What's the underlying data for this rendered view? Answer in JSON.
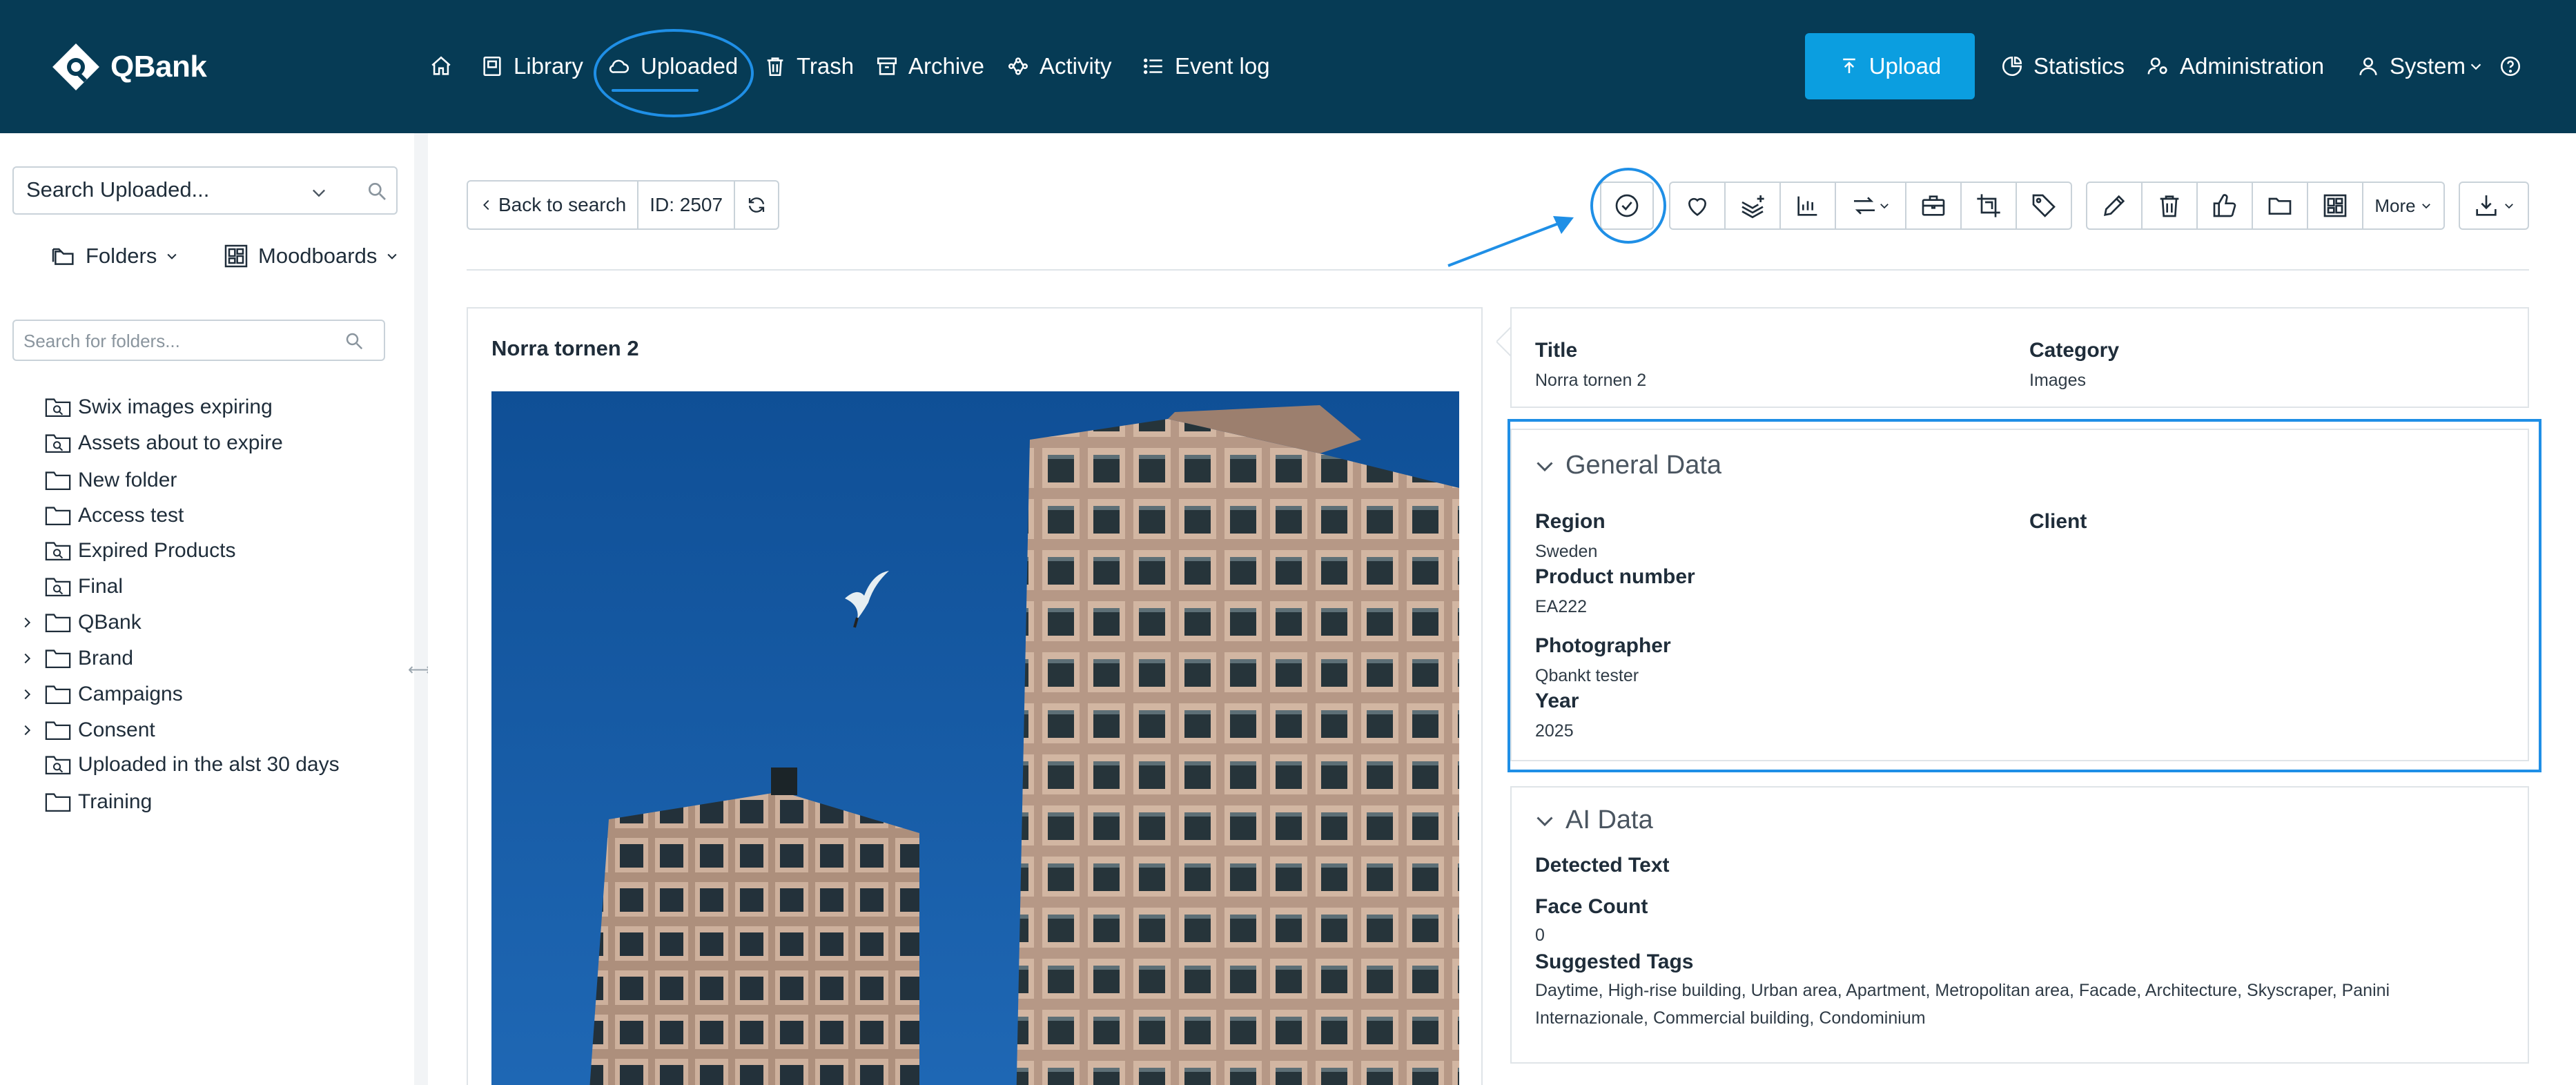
{
  "brand": {
    "name": "QBank"
  },
  "nav": {
    "home": "",
    "library": "Library",
    "uploaded": "Uploaded",
    "trash": "Trash",
    "archive": "Archive",
    "activity": "Activity",
    "eventlog": "Event log",
    "upload": "Upload",
    "statistics": "Statistics",
    "administration": "Administration",
    "system": "System"
  },
  "sidebar": {
    "search_value": "Search Uploaded...",
    "folders_label": "Folders",
    "moodboards_label": "Moodboards",
    "folder_search_placeholder": "Search for folders...",
    "items": [
      {
        "label": "Swix images expiring",
        "type": "smart",
        "expandable": false
      },
      {
        "label": "Assets about to expire",
        "type": "smart",
        "expandable": false
      },
      {
        "label": "New folder",
        "type": "folder",
        "expandable": false
      },
      {
        "label": "Access test",
        "type": "folder",
        "expandable": false
      },
      {
        "label": "Expired Products",
        "type": "smart",
        "expandable": false
      },
      {
        "label": "Final",
        "type": "smart",
        "expandable": false
      },
      {
        "label": "QBank",
        "type": "folder",
        "expandable": true
      },
      {
        "label": "Brand",
        "type": "folder",
        "expandable": true
      },
      {
        "label": "Campaigns",
        "type": "folder",
        "expandable": true
      },
      {
        "label": "Consent",
        "type": "folder",
        "expandable": true
      },
      {
        "label": "Uploaded in the alst 30 days",
        "type": "smart",
        "expandable": false
      },
      {
        "label": "Training",
        "type": "folder",
        "expandable": false
      }
    ]
  },
  "toolbar": {
    "back_label": "Back to search",
    "id_label": "ID: 2507",
    "more_label": "More"
  },
  "preview": {
    "title": "Norra tornen 2"
  },
  "summary": {
    "title_label": "Title",
    "title_value": "Norra tornen 2",
    "category_label": "Category",
    "category_value": "Images"
  },
  "general": {
    "heading": "General Data",
    "region_label": "Region",
    "region_value": "Sweden",
    "client_label": "Client",
    "product_label": "Product number",
    "product_value": "EA222",
    "photographer_label": "Photographer",
    "photographer_value": "Qbankt tester",
    "year_label": "Year",
    "year_value": "2025"
  },
  "ai": {
    "heading": "AI Data",
    "detected_label": "Detected Text",
    "face_label": "Face Count",
    "face_value": "0",
    "tags_label": "Suggested Tags",
    "tags_line1": "Daytime, High-rise building, Urban area, Apartment, Metropolitan area, Facade, Architecture, Skyscraper, Panini",
    "tags_line2": "Internazionale, Commercial building, Condominium"
  },
  "colors": {
    "topbar": "#063b55",
    "accent": "#0b9ee0",
    "highlight": "#1f8fe6"
  }
}
